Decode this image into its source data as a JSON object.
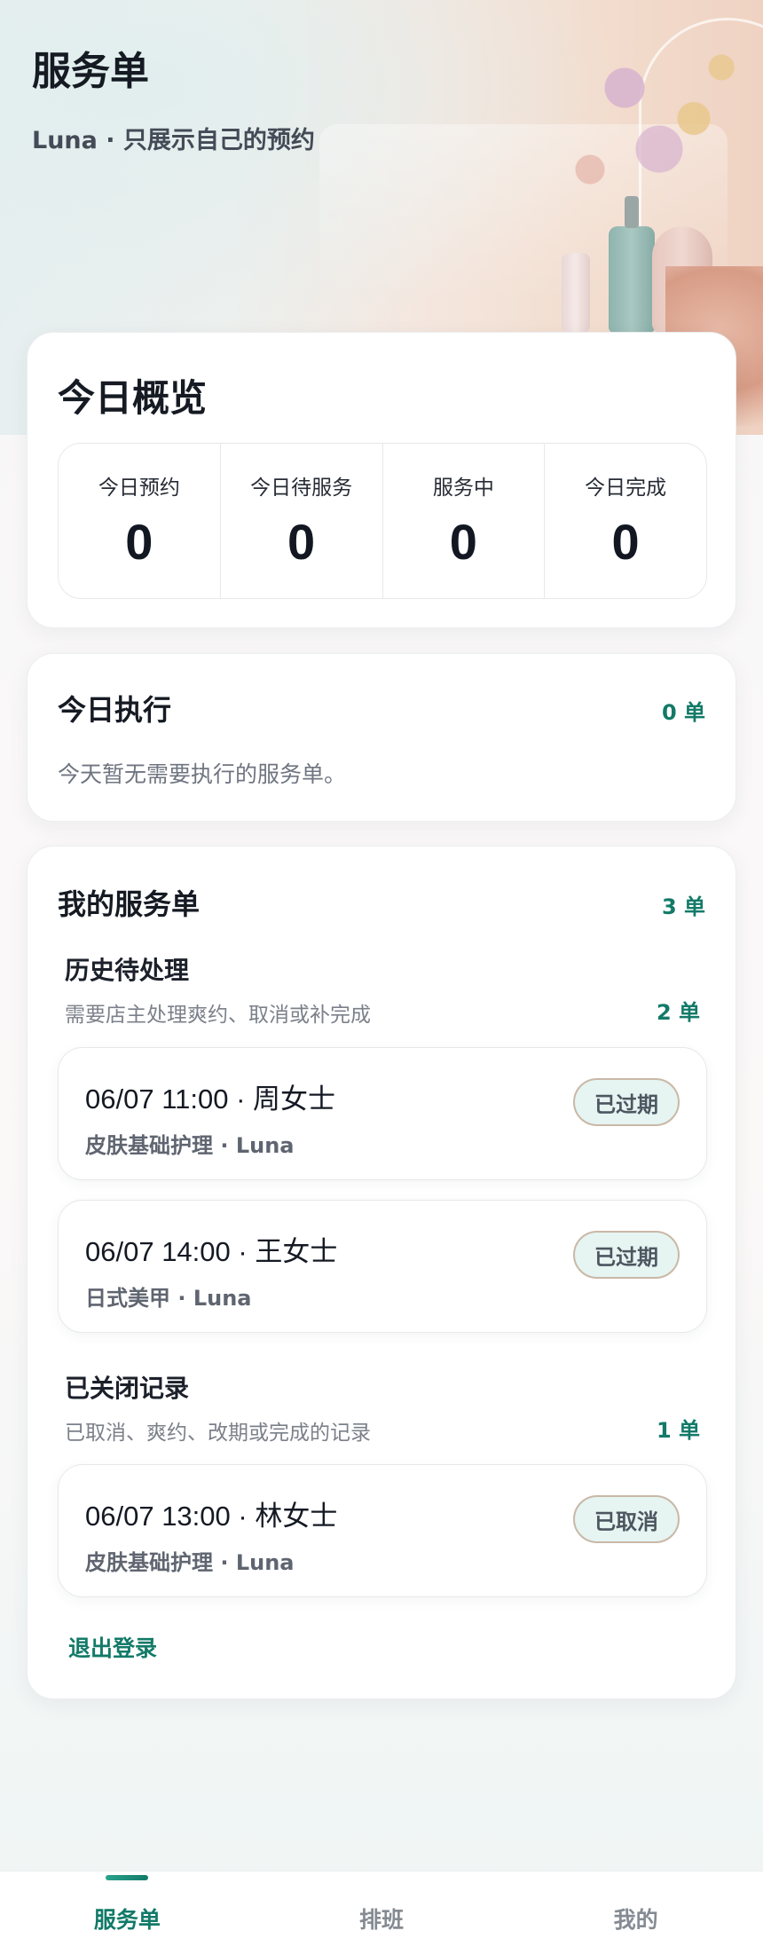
{
  "header": {
    "title": "服务单",
    "subtitle": "Luna · 只展示自己的预约"
  },
  "overview": {
    "title": "今日概览",
    "stats": [
      {
        "label": "今日预约",
        "value": "0"
      },
      {
        "label": "今日待服务",
        "value": "0"
      },
      {
        "label": "服务中",
        "value": "0"
      },
      {
        "label": "今日完成",
        "value": "0"
      }
    ]
  },
  "today": {
    "title": "今日执行",
    "count": "0 单",
    "empty_text": "今天暂无需要执行的服务单。"
  },
  "orders": {
    "title": "我的服务单",
    "count": "3 单",
    "pending": {
      "title": "历史待处理",
      "desc": "需要店主处理爽约、取消或补完成",
      "count": "2 单",
      "items": [
        {
          "main": "06/07 11:00 · 周女士",
          "sub": "皮肤基础护理 · Luna",
          "status": "已过期"
        },
        {
          "main": "06/07 14:00 · 王女士",
          "sub": "日式美甲 · Luna",
          "status": "已过期"
        }
      ]
    },
    "closed": {
      "title": "已关闭记录",
      "desc": "已取消、爽约、改期或完成的记录",
      "count": "1 单",
      "items": [
        {
          "main": "06/07 13:00 · 林女士",
          "sub": "皮肤基础护理 · Luna",
          "status": "已取消"
        }
      ]
    },
    "logout": "退出登录"
  },
  "tabbar": {
    "items": [
      {
        "label": "服务单",
        "active": true
      },
      {
        "label": "排班",
        "active": false
      },
      {
        "label": "我的",
        "active": false
      }
    ]
  },
  "colors": {
    "accent": "#127a68",
    "pill_bg": "#e6f4f2"
  }
}
